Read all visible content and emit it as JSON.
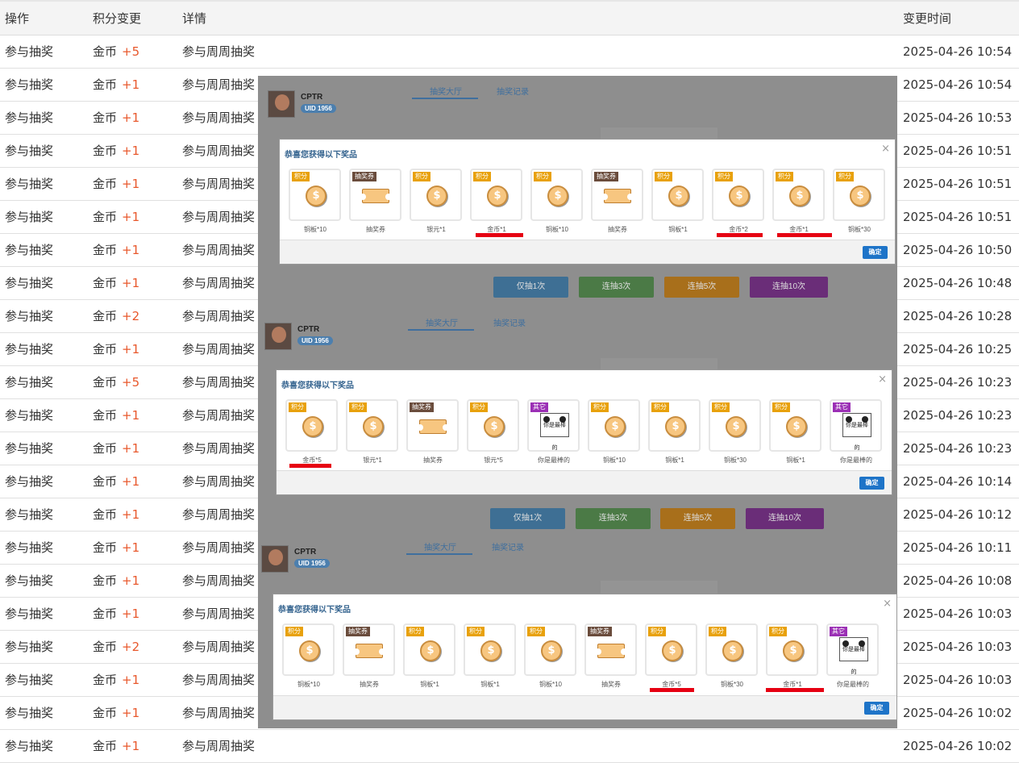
{
  "table": {
    "headers": {
      "action": "操作",
      "change": "积分变更",
      "detail": "详情",
      "time": "变更时间"
    },
    "rows": [
      {
        "action": "参与抽奖",
        "currency": "金币",
        "delta": "+5",
        "detail": "参与周周抽奖",
        "time": "2025-04-26 10:54"
      },
      {
        "action": "参与抽奖",
        "currency": "金币",
        "delta": "+1",
        "detail": "参与周周抽奖",
        "time": "2025-04-26 10:54"
      },
      {
        "action": "参与抽奖",
        "currency": "金币",
        "delta": "+1",
        "detail": "参与周周抽奖",
        "time": "2025-04-26 10:53"
      },
      {
        "action": "参与抽奖",
        "currency": "金币",
        "delta": "+1",
        "detail": "参与周周抽奖",
        "time": "2025-04-26 10:51"
      },
      {
        "action": "参与抽奖",
        "currency": "金币",
        "delta": "+1",
        "detail": "参与周周抽奖",
        "time": "2025-04-26 10:51"
      },
      {
        "action": "参与抽奖",
        "currency": "金币",
        "delta": "+1",
        "detail": "参与周周抽奖",
        "time": "2025-04-26 10:51"
      },
      {
        "action": "参与抽奖",
        "currency": "金币",
        "delta": "+1",
        "detail": "参与周周抽奖",
        "time": "2025-04-26 10:50"
      },
      {
        "action": "参与抽奖",
        "currency": "金币",
        "delta": "+1",
        "detail": "参与周周抽奖",
        "time": "2025-04-26 10:48"
      },
      {
        "action": "参与抽奖",
        "currency": "金币",
        "delta": "+2",
        "detail": "参与周周抽奖",
        "time": "2025-04-26 10:28"
      },
      {
        "action": "参与抽奖",
        "currency": "金币",
        "delta": "+1",
        "detail": "参与周周抽奖",
        "time": "2025-04-26 10:25"
      },
      {
        "action": "参与抽奖",
        "currency": "金币",
        "delta": "+5",
        "detail": "参与周周抽奖",
        "time": "2025-04-26 10:23"
      },
      {
        "action": "参与抽奖",
        "currency": "金币",
        "delta": "+1",
        "detail": "参与周周抽奖",
        "time": "2025-04-26 10:23"
      },
      {
        "action": "参与抽奖",
        "currency": "金币",
        "delta": "+1",
        "detail": "参与周周抽奖",
        "time": "2025-04-26 10:23"
      },
      {
        "action": "参与抽奖",
        "currency": "金币",
        "delta": "+1",
        "detail": "参与周周抽奖",
        "time": "2025-04-26 10:14"
      },
      {
        "action": "参与抽奖",
        "currency": "金币",
        "delta": "+1",
        "detail": "参与周周抽奖",
        "time": "2025-04-26 10:12"
      },
      {
        "action": "参与抽奖",
        "currency": "金币",
        "delta": "+1",
        "detail": "参与周周抽奖",
        "time": "2025-04-26 10:11"
      },
      {
        "action": "参与抽奖",
        "currency": "金币",
        "delta": "+1",
        "detail": "参与周周抽奖",
        "time": "2025-04-26 10:08"
      },
      {
        "action": "参与抽奖",
        "currency": "金币",
        "delta": "+1",
        "detail": "参与周周抽奖",
        "time": "2025-04-26 10:03"
      },
      {
        "action": "参与抽奖",
        "currency": "金币",
        "delta": "+2",
        "detail": "参与周周抽奖",
        "time": "2025-04-26 10:03"
      },
      {
        "action": "参与抽奖",
        "currency": "金币",
        "delta": "+1",
        "detail": "参与周周抽奖",
        "time": "2025-04-26 10:03"
      },
      {
        "action": "参与抽奖",
        "currency": "金币",
        "delta": "+1",
        "detail": "参与周周抽奖",
        "time": "2025-04-26 10:02"
      },
      {
        "action": "参与抽奖",
        "currency": "金币",
        "delta": "+1",
        "detail": "参与周周抽奖",
        "time": "2025-04-26 10:02"
      }
    ]
  },
  "colors": {
    "delta": "#e8582c",
    "highlight": "#e60012",
    "score_tag": "#e8a10c",
    "ticket_tag": "#6a4c3c",
    "other_tag": "#9b2fb5",
    "confirm": "#1e74c8"
  },
  "lottery": {
    "user_name": "CPTR",
    "uid": "UID 1956",
    "tabs": [
      "抽奖大厅",
      "抽奖记录"
    ],
    "draw_buttons": [
      "仅抽1次",
      "连抽3次",
      "连抽5次",
      "连抽10次"
    ],
    "modal_title": "恭喜您获得以下奖品",
    "confirm_label": "确定",
    "close_glyph": "×",
    "tag_labels": {
      "score": "积分",
      "ticket": "抽奖券",
      "other": "其它"
    },
    "coin_glyph": "$",
    "panda_text": "你是最棒的",
    "results": [
      {
        "prizes": [
          {
            "tag": "score",
            "icon": "coin",
            "label": "铜板*10"
          },
          {
            "tag": "ticket",
            "icon": "ticket",
            "label": "抽奖券"
          },
          {
            "tag": "score",
            "icon": "coin",
            "label": "银元*1"
          },
          {
            "tag": "score",
            "icon": "coin",
            "label": "金币*1",
            "highlight": true
          },
          {
            "tag": "score",
            "icon": "coin",
            "label": "铜板*10"
          },
          {
            "tag": "ticket",
            "icon": "ticket",
            "label": "抽奖券"
          },
          {
            "tag": "score",
            "icon": "coin",
            "label": "铜板*1"
          },
          {
            "tag": "score",
            "icon": "coin",
            "label": "金币*2",
            "highlight": true
          },
          {
            "tag": "score",
            "icon": "coin",
            "label": "金币*1",
            "highlight": true
          },
          {
            "tag": "score",
            "icon": "coin",
            "label": "铜板*30"
          }
        ]
      },
      {
        "prizes": [
          {
            "tag": "score",
            "icon": "coin",
            "label": "金币*5",
            "highlight": true
          },
          {
            "tag": "score",
            "icon": "coin",
            "label": "银元*1"
          },
          {
            "tag": "ticket",
            "icon": "ticket",
            "label": "抽奖券"
          },
          {
            "tag": "score",
            "icon": "coin",
            "label": "银元*5"
          },
          {
            "tag": "other",
            "icon": "panda",
            "label": "你是最棒的"
          },
          {
            "tag": "score",
            "icon": "coin",
            "label": "铜板*10"
          },
          {
            "tag": "score",
            "icon": "coin",
            "label": "铜板*1"
          },
          {
            "tag": "score",
            "icon": "coin",
            "label": "铜板*30"
          },
          {
            "tag": "score",
            "icon": "coin",
            "label": "铜板*1"
          },
          {
            "tag": "other",
            "icon": "panda",
            "label": "你是最棒的"
          }
        ]
      },
      {
        "prizes": [
          {
            "tag": "score",
            "icon": "coin",
            "label": "铜板*10"
          },
          {
            "tag": "ticket",
            "icon": "ticket",
            "label": "抽奖券"
          },
          {
            "tag": "score",
            "icon": "coin",
            "label": "铜板*1"
          },
          {
            "tag": "score",
            "icon": "coin",
            "label": "铜板*1"
          },
          {
            "tag": "score",
            "icon": "coin",
            "label": "铜板*10"
          },
          {
            "tag": "ticket",
            "icon": "ticket",
            "label": "抽奖券"
          },
          {
            "tag": "score",
            "icon": "coin",
            "label": "金币*5",
            "highlight": true
          },
          {
            "tag": "score",
            "icon": "coin",
            "label": "铜板*30"
          },
          {
            "tag": "score",
            "icon": "coin",
            "label": "金币*1",
            "highlight": true
          },
          {
            "tag": "other",
            "icon": "panda",
            "label": "你是最棒的"
          }
        ]
      }
    ]
  }
}
